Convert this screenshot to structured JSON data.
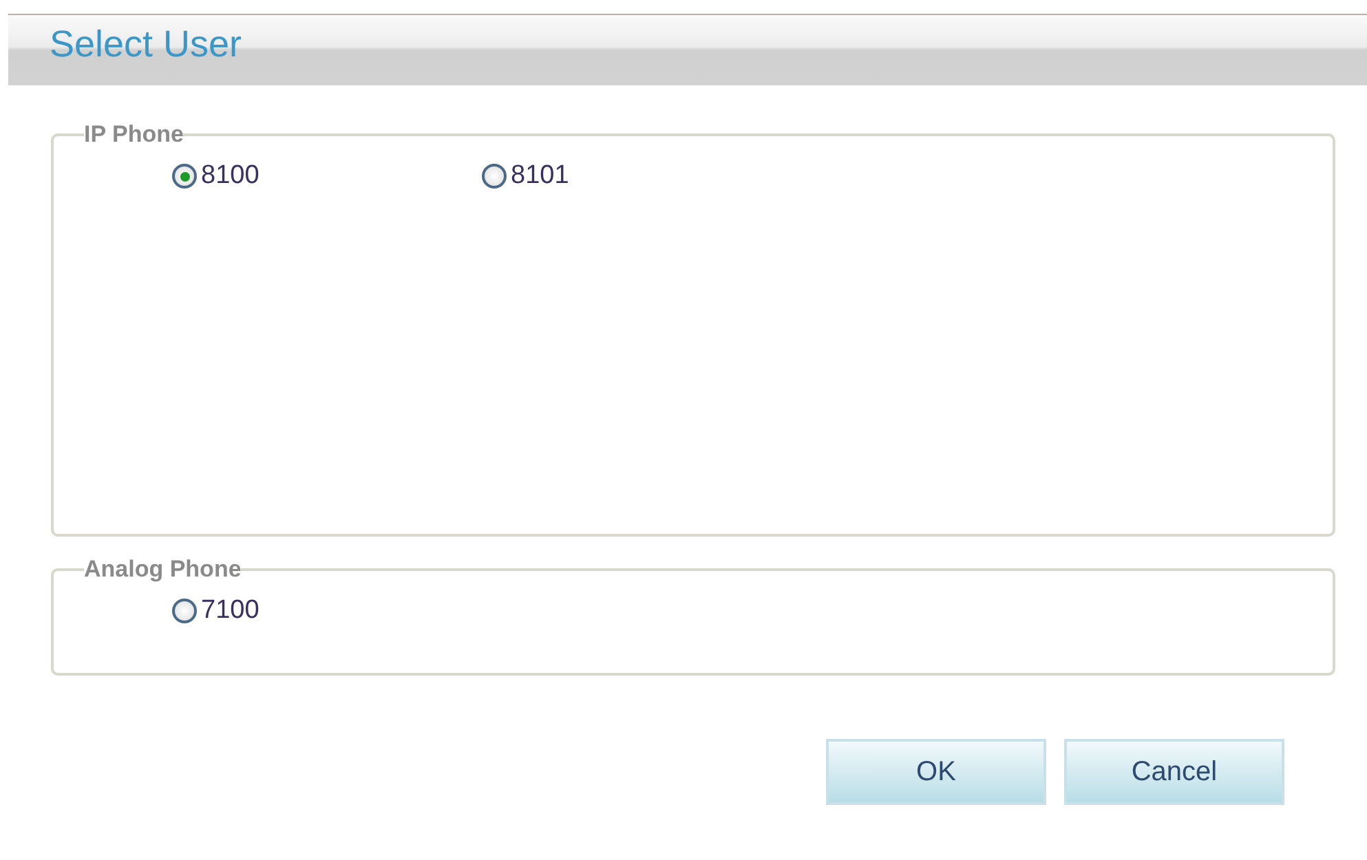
{
  "window": {
    "title": "Select User"
  },
  "groups": [
    {
      "label": "IP Phone",
      "options": [
        {
          "label": "8100",
          "selected": true
        },
        {
          "label": "8101",
          "selected": false
        }
      ]
    },
    {
      "label": "Analog Phone",
      "options": [
        {
          "label": "7100",
          "selected": false
        }
      ]
    }
  ],
  "buttons": [
    "OK",
    "Cancel"
  ]
}
